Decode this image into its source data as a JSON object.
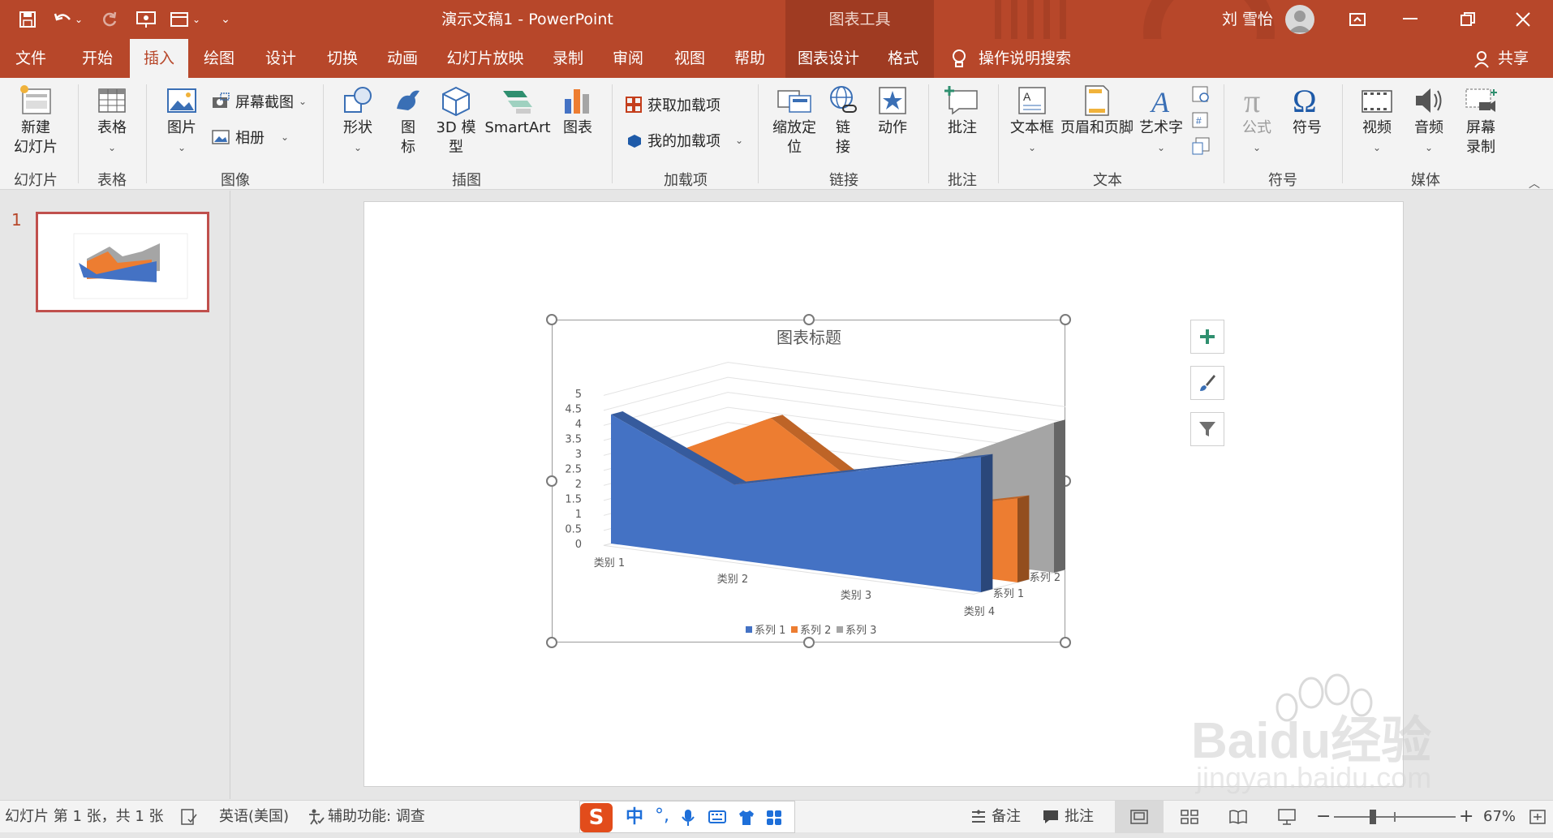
{
  "window": {
    "doc_title": "演示文稿1  -  PowerPoint",
    "context_title": "图表工具",
    "user_name": "刘 雪怡"
  },
  "tabs": [
    "文件",
    "开始",
    "插入",
    "绘图",
    "设计",
    "切换",
    "动画",
    "幻灯片放映",
    "录制",
    "审阅",
    "视图",
    "帮助",
    "图表设计",
    "格式"
  ],
  "active_tab": "插入",
  "search_label": "操作说明搜索",
  "share_label": "共享",
  "ribbon": {
    "new_slide": "新建\n幻灯片",
    "table": "表格",
    "picture": "图片",
    "screenshot": "屏幕截图",
    "album": "相册",
    "shapes": "形状",
    "icons": "图\n标",
    "model3d": "3D 模\n型",
    "smartart": "SmartArt",
    "chart": "图表",
    "get_addins": "获取加载项",
    "my_addins": "我的加载项",
    "zoom": "缩放定\n位",
    "link": "链\n接",
    "action": "动作",
    "comment": "批注",
    "textbox": "文本框",
    "header_footer": "页眉和页脚",
    "wordart": "艺术字",
    "equation": "公式",
    "symbol": "符号",
    "video": "视频",
    "audio": "音频",
    "screen_record": "屏幕\n录制",
    "groups": [
      "幻灯片",
      "表格",
      "图像",
      "插图",
      "加载项",
      "链接",
      "批注",
      "文本",
      "符号",
      "媒体"
    ]
  },
  "slide_number": "1",
  "chart_data": {
    "type": "area",
    "subtype": "3d-area",
    "title": "图表标题",
    "categories": [
      "类别 1",
      "类别 2",
      "类别 3",
      "类别 4"
    ],
    "series": [
      {
        "name": "系列 1",
        "values": [
          4.3,
          2.5,
          3.5,
          4.5
        ],
        "color": "#4472c4"
      },
      {
        "name": "系列 2",
        "values": [
          2.4,
          4.4,
          1.8,
          2.8
        ],
        "color": "#ed7d31"
      },
      {
        "name": "系列 3",
        "values": [
          2,
          2,
          3,
          5
        ],
        "color": "#a5a5a5"
      }
    ],
    "y_ticks": [
      "0",
      "0.5",
      "1",
      "1.5",
      "2",
      "2.5",
      "3",
      "3.5",
      "4",
      "4.5",
      "5"
    ],
    "ylim": [
      0,
      5
    ],
    "depth_labels": [
      "系列 1",
      "系列 2",
      "系列 3"
    ],
    "legend_position": "bottom",
    "grid": true
  },
  "status": {
    "slide_info": "幻灯片 第 1 张，共 1 张",
    "language": "英语(美国)",
    "accessibility": "辅助功能: 调查",
    "notes": "备注",
    "comments": "批注",
    "zoom": "67%"
  },
  "ime": {
    "mode": "中"
  },
  "watermark": {
    "text": "Baidu经验",
    "sub": "jingyan.baidu.com"
  }
}
